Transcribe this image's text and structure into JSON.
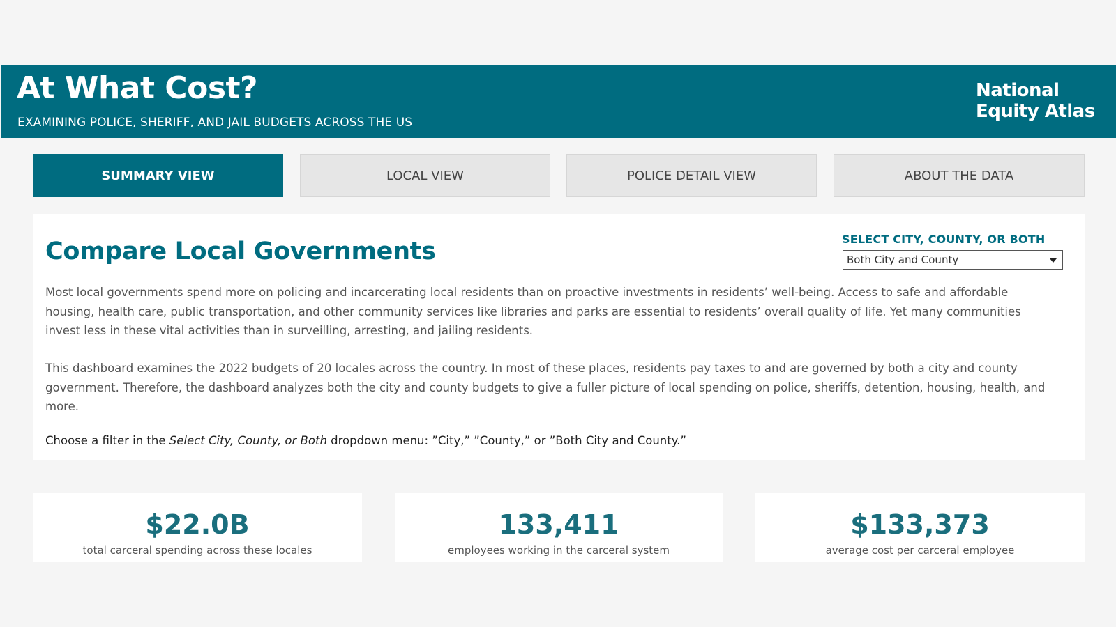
{
  "header": {
    "title": "At What Cost?",
    "subtitle": "EXAMINING POLICE, SHERIFF, AND JAIL BUDGETS ACROSS THE US",
    "brand_line1": "National",
    "brand_line2": "Equity Atlas"
  },
  "tabs": [
    {
      "label": "SUMMARY VIEW",
      "active": true
    },
    {
      "label": "LOCAL VIEW",
      "active": false
    },
    {
      "label": "POLICE DETAIL VIEW",
      "active": false
    },
    {
      "label": "ABOUT THE DATA",
      "active": false
    }
  ],
  "main": {
    "heading": "Compare Local Governments",
    "filter": {
      "label": "SELECT CITY, COUNTY, OR BOTH",
      "value": "Both City and County"
    },
    "paragraph1": "Most local governments spend more on policing and incarcerating local residents than on proactive investments in residents’ well-being. Access to safe and affordable housing, health care, public transportation, and other community services like libraries and parks are essential to residents’ overall quality of life. Yet many communities invest less in these vital activities than in surveilling, arresting, and jailing residents.",
    "paragraph2": "This dashboard examines the 2022 budgets of 20 locales across the country. In most of these places, residents pay taxes to and are governed by both a city and county government. Therefore, the dashboard analyzes both the city and county budgets to give a fuller picture of local spending on police, sheriffs, detention, housing, health, and more.",
    "instruction_before": "Choose a filter in the ",
    "instruction_emphasis": "Select City, County, or Both",
    "instruction_after": " dropdown menu: ”City,” ”County,” or ”Both City and County.”"
  },
  "kpis": [
    {
      "value": "$22.0B",
      "label": "total carceral spending across these locales"
    },
    {
      "value": "133,411",
      "label": "employees working in the carceral system"
    },
    {
      "value": "$133,373",
      "label": "average cost per carceral employee"
    }
  ],
  "colors": {
    "brand_teal": "#006c80",
    "page_bg": "#f5f5f5",
    "tab_inactive_bg": "#e6e6e6",
    "card_bg": "#ffffff"
  }
}
